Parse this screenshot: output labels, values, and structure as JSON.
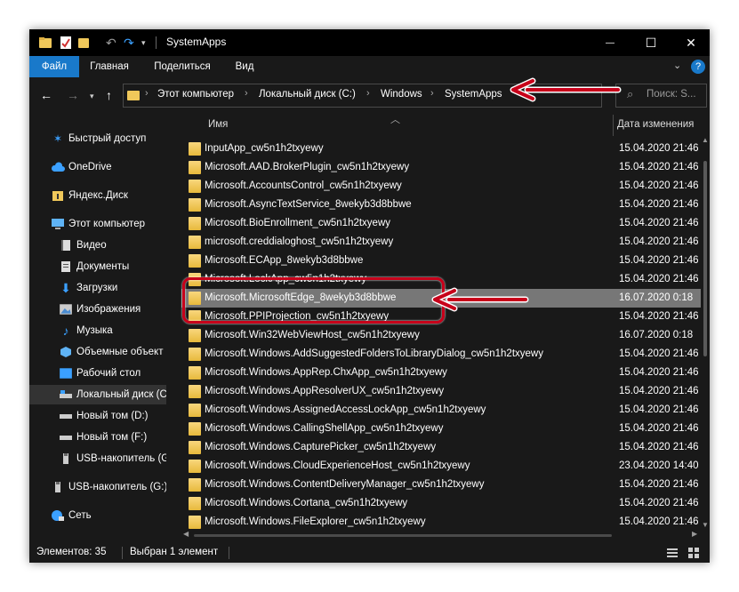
{
  "window": {
    "title": "SystemApps",
    "controls": {
      "minimize": "—",
      "maximize": "☐",
      "close": "✕"
    }
  },
  "ribbon": {
    "tabs": [
      "Файл",
      "Главная",
      "Поделиться",
      "Вид"
    ],
    "help": "?"
  },
  "address": {
    "crumbs": [
      "Этот компьютер",
      "Локальный диск (C:)",
      "Windows",
      "SystemApps"
    ]
  },
  "search": {
    "placeholder": "Поиск: S..."
  },
  "sidebar": {
    "items": [
      {
        "label": "Быстрый доступ",
        "icon": "star-icon"
      },
      {
        "label": "OneDrive",
        "icon": "cloud-icon"
      },
      {
        "label": "Яндекс.Диск",
        "icon": "yandex-disk-icon"
      },
      {
        "label": "Этот компьютер",
        "icon": "computer-icon"
      },
      {
        "label": "Видео",
        "icon": "video-icon"
      },
      {
        "label": "Документы",
        "icon": "documents-icon"
      },
      {
        "label": "Загрузки",
        "icon": "downloads-icon"
      },
      {
        "label": "Изображения",
        "icon": "pictures-icon"
      },
      {
        "label": "Музыка",
        "icon": "music-icon"
      },
      {
        "label": "Объемные объект",
        "icon": "3d-objects-icon"
      },
      {
        "label": "Рабочий стол",
        "icon": "desktop-icon"
      },
      {
        "label": "Локальный диск (С",
        "icon": "drive-icon"
      },
      {
        "label": "Новый том (D:)",
        "icon": "drive-icon"
      },
      {
        "label": "Новый том (F:)",
        "icon": "drive-icon"
      },
      {
        "label": "USB-накопитель (G",
        "icon": "usb-icon"
      },
      {
        "label": "USB-накопитель (G:)",
        "icon": "usb-icon"
      },
      {
        "label": "Сеть",
        "icon": "network-icon"
      }
    ]
  },
  "columns": {
    "name": "Имя",
    "date": "Дата изменения"
  },
  "files": [
    {
      "name": "InputApp_cw5n1h2txyewy",
      "date": "15.04.2020 21:46"
    },
    {
      "name": "Microsoft.AAD.BrokerPlugin_cw5n1h2txyewy",
      "date": "15.04.2020 21:46"
    },
    {
      "name": "Microsoft.AccountsControl_cw5n1h2txyewy",
      "date": "15.04.2020 21:46"
    },
    {
      "name": "Microsoft.AsyncTextService_8wekyb3d8bbwe",
      "date": "15.04.2020 21:46"
    },
    {
      "name": "Microsoft.BioEnrollment_cw5n1h2txyewy",
      "date": "15.04.2020 21:46"
    },
    {
      "name": "microsoft.creddialoghost_cw5n1h2txyewy",
      "date": "15.04.2020 21:46"
    },
    {
      "name": "Microsoft.ECApp_8wekyb3d8bbwe",
      "date": "15.04.2020 21:46"
    },
    {
      "name": "Microsoft.LockApp_cw5n1h2txyewy",
      "date": "15.04.2020 21:46"
    },
    {
      "name": "Microsoft.MicrosoftEdge_8wekyb3d8bbwe",
      "date": "16.07.2020 0:18",
      "selected": true
    },
    {
      "name": "Microsoft.PPIProjection_cw5n1h2txyewy",
      "date": "15.04.2020 21:46"
    },
    {
      "name": "Microsoft.Win32WebViewHost_cw5n1h2txyewy",
      "date": "16.07.2020 0:18"
    },
    {
      "name": "Microsoft.Windows.AddSuggestedFoldersToLibraryDialog_cw5n1h2txyewy",
      "date": "15.04.2020 21:46"
    },
    {
      "name": "Microsoft.Windows.AppRep.ChxApp_cw5n1h2txyewy",
      "date": "15.04.2020 21:46"
    },
    {
      "name": "Microsoft.Windows.AppResolverUX_cw5n1h2txyewy",
      "date": "15.04.2020 21:46"
    },
    {
      "name": "Microsoft.Windows.AssignedAccessLockApp_cw5n1h2txyewy",
      "date": "15.04.2020 21:46"
    },
    {
      "name": "Microsoft.Windows.CallingShellApp_cw5n1h2txyewy",
      "date": "15.04.2020 21:46"
    },
    {
      "name": "Microsoft.Windows.CapturePicker_cw5n1h2txyewy",
      "date": "15.04.2020 21:46"
    },
    {
      "name": "Microsoft.Windows.CloudExperienceHost_cw5n1h2txyewy",
      "date": "23.04.2020 14:40"
    },
    {
      "name": "Microsoft.Windows.ContentDeliveryManager_cw5n1h2txyewy",
      "date": "15.04.2020 21:46"
    },
    {
      "name": "Microsoft.Windows.Cortana_cw5n1h2txyewy",
      "date": "15.04.2020 21:46"
    },
    {
      "name": "Microsoft.Windows.FileExplorer_cw5n1h2txyewy",
      "date": "15.04.2020 21:46"
    }
  ],
  "status": {
    "count": "Элементов: 35",
    "selected": "Выбран 1 элемент"
  },
  "colors": {
    "accent": "#1979ca",
    "annotation": "#c7001a",
    "folder": "#f0c85a",
    "selected_row": "#777777"
  }
}
